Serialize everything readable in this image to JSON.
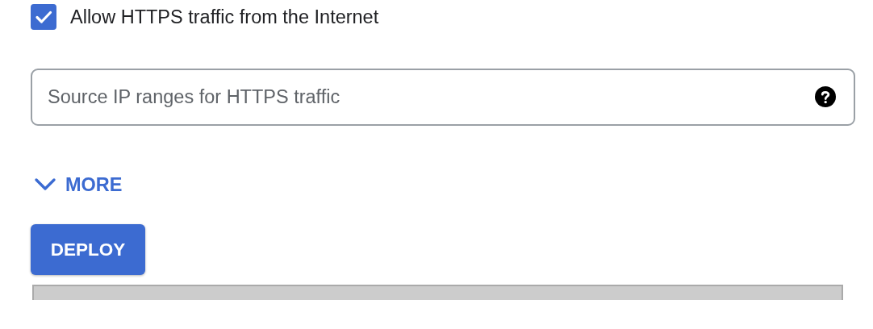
{
  "https_checkbox": {
    "label": "Allow HTTPS traffic from the Internet",
    "checked": true
  },
  "source_ip_field": {
    "placeholder": "Source IP ranges for HTTPS traffic"
  },
  "more_toggle": {
    "label": "MORE",
    "expanded": false
  },
  "deploy_button": {
    "label": "DEPLOY"
  }
}
